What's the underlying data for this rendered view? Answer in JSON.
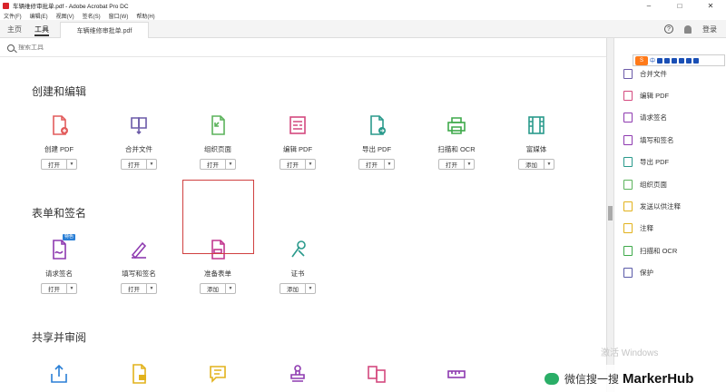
{
  "window": {
    "title": "车辆维修审批单.pdf - Adobe Acrobat Pro DC",
    "minimize": "–",
    "maximize": "□",
    "close": "✕"
  },
  "menu": [
    "文件(F)",
    "编辑(E)",
    "视图(V)",
    "签名(S)",
    "窗口(W)",
    "帮助(H)"
  ],
  "tabs": {
    "home": "主页",
    "tools": "工具",
    "document": "车辆维修审批单.pdf"
  },
  "topbar": {
    "help": "?",
    "login": "登录"
  },
  "search": {
    "placeholder": "搜索工具"
  },
  "sections": [
    {
      "title": "创建和编辑",
      "tools": [
        {
          "label": "创建 PDF",
          "button": "打开",
          "icon": "create-pdf-icon",
          "color": "#e25c5c"
        },
        {
          "label": "合并文件",
          "button": "打开",
          "icon": "combine-files-icon",
          "color": "#6b5aa8"
        },
        {
          "label": "组织页面",
          "button": "打开",
          "icon": "organize-pages-icon",
          "color": "#5cb35c"
        },
        {
          "label": "编辑 PDF",
          "button": "打开",
          "icon": "edit-pdf-icon",
          "color": "#d4497e"
        },
        {
          "label": "导出 PDF",
          "button": "打开",
          "icon": "export-pdf-icon",
          "color": "#2a9a8c"
        },
        {
          "label": "扫描和 OCR",
          "button": "打开",
          "icon": "scan-ocr-icon",
          "color": "#3faa4b"
        },
        {
          "label": "富媒体",
          "button": "添加",
          "icon": "rich-media-icon",
          "color": "#2a9a8c"
        }
      ]
    },
    {
      "title": "表单和签名",
      "tools": [
        {
          "label": "请求签名",
          "button": "打开",
          "icon": "request-signature-icon",
          "color": "#8e3ab0",
          "badge": "特色"
        },
        {
          "label": "填写和签名",
          "button": "打开",
          "icon": "fill-sign-icon",
          "color": "#8e3ab0"
        },
        {
          "label": "准备表单",
          "button": "添加",
          "icon": "prepare-form-icon",
          "color": "#c2378f"
        },
        {
          "label": "证书",
          "button": "添加",
          "icon": "certificates-icon",
          "color": "#2a9a8c"
        }
      ]
    },
    {
      "title": "共享并审阅",
      "tools": [
        {
          "icon": "share-icon",
          "color": "#2a7fd6"
        },
        {
          "icon": "send-for-comments-icon",
          "color": "#e2b21c"
        },
        {
          "icon": "comment-icon",
          "color": "#e2b21c"
        },
        {
          "icon": "stamp-icon",
          "color": "#8e3ab0"
        },
        {
          "icon": "compare-files-icon",
          "color": "#d4497e"
        },
        {
          "icon": "measure-icon",
          "color": "#8e3ab0"
        }
      ]
    }
  ],
  "right_panel": {
    "ime_label": "中",
    "items": [
      {
        "label": "合并文件",
        "icon": "combine-files-icon",
        "color": "#6b5aa8"
      },
      {
        "label": "编辑 PDF",
        "icon": "edit-pdf-icon",
        "color": "#d4497e"
      },
      {
        "label": "请求签名",
        "icon": "request-signature-icon",
        "color": "#8e3ab0"
      },
      {
        "label": "填写和签名",
        "icon": "fill-sign-icon",
        "color": "#8e3ab0"
      },
      {
        "label": "导出 PDF",
        "icon": "export-pdf-icon",
        "color": "#2a9a8c"
      },
      {
        "label": "组织页面",
        "icon": "organize-pages-icon",
        "color": "#5cb35c"
      },
      {
        "label": "发送以供注释",
        "icon": "send-for-comments-icon",
        "color": "#e2b21c"
      },
      {
        "label": "注释",
        "icon": "comment-icon",
        "color": "#e2b21c"
      },
      {
        "label": "扫描和 OCR",
        "icon": "scan-ocr-icon",
        "color": "#3faa4b"
      },
      {
        "label": "保护",
        "icon": "protect-icon",
        "color": "#5a5aa8"
      }
    ]
  },
  "overlay": {
    "watermark": "激活 Windows",
    "wechat": "微信搜一搜",
    "brand": "MarkerHub"
  }
}
